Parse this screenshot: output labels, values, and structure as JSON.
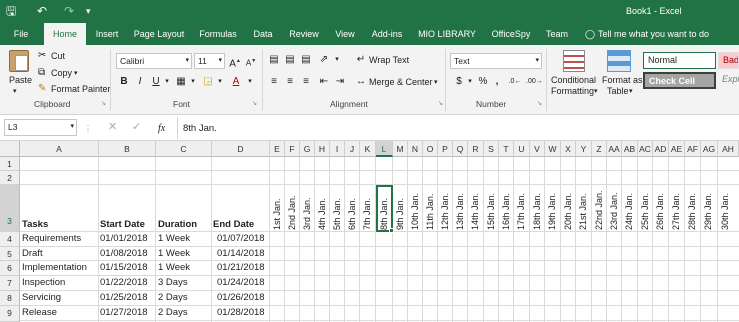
{
  "window": {
    "title": "Book1 - Excel"
  },
  "qat": {
    "save": "save-icon",
    "undo": "undo-icon",
    "redo": "redo-icon"
  },
  "tabs": [
    "File",
    "Home",
    "Insert",
    "Page Layout",
    "Formulas",
    "Data",
    "Review",
    "View",
    "Add-ins",
    "MIO LIBRARY",
    "OfficeSpy",
    "Team"
  ],
  "active_tab": "Home",
  "tell_me": "Tell me what you want to do",
  "ribbon": {
    "clipboard": {
      "paste": "Paste",
      "cut": "Cut",
      "copy": "Copy",
      "format_painter": "Format Painter",
      "group": "Clipboard"
    },
    "font": {
      "name": "Calibri",
      "size": "11",
      "bold": "B",
      "italic": "I",
      "underline": "U",
      "group": "Font"
    },
    "alignment": {
      "wrap": "Wrap Text",
      "merge": "Merge & Center",
      "group": "Alignment"
    },
    "number": {
      "format": "Text",
      "currency": "$",
      "percent": "%",
      "comma": ",",
      "group": "Number"
    },
    "styles": {
      "conditional": "Conditional",
      "formatting": "Formatting",
      "format_as": "Format as",
      "table": "Table",
      "normal": "Normal",
      "bad": "Bad",
      "check_cell": "Check Cell",
      "explanatory": "Expla"
    }
  },
  "formula_bar": {
    "name_box": "L3",
    "fx": "fx",
    "value": "8th Jan."
  },
  "columns": [
    "A",
    "B",
    "C",
    "D",
    "E",
    "F",
    "G",
    "H",
    "I",
    "J",
    "K",
    "L",
    "M",
    "N",
    "O",
    "P",
    "Q",
    "R",
    "S",
    "T",
    "U",
    "V",
    "W",
    "X",
    "Y",
    "Z",
    "AA",
    "AB",
    "AC",
    "AD",
    "AE",
    "AF",
    "AG",
    "AH"
  ],
  "selected_column": "L",
  "rows": [
    "1",
    "2",
    "3",
    "4",
    "5",
    "6",
    "7",
    "8",
    "9"
  ],
  "selected_row": "3",
  "headers": {
    "tasks": "Tasks",
    "start": "Start Date",
    "duration": "Duration",
    "end": "End Date"
  },
  "date_headers": [
    "1st Jan.",
    "2nd Jan.",
    "3rd Jan.",
    "4th Jan.",
    "5th Jan.",
    "6th Jan.",
    "7th Jan.",
    "8th Jan.",
    "9th Jan.",
    "10th Jan.",
    "11th Jan.",
    "12th Jan.",
    "13th Jan.",
    "14th Jan.",
    "15th Jan.",
    "16th Jan.",
    "17th Jan.",
    "18th Jan.",
    "19th Jan.",
    "20th Jan.",
    "21st Jan.",
    "22nd Jan.",
    "23rd Jan.",
    "24th Jan.",
    "25th Jan.",
    "26th Jan.",
    "27th Jan.",
    "28th Jan.",
    "29th Jan.",
    "30th Jan."
  ],
  "tasks": [
    {
      "task": "Requirements",
      "start": "01/01/2018",
      "duration": "1 Week",
      "end": "01/07/2018"
    },
    {
      "task": "Draft",
      "start": "01/08/2018",
      "duration": "1 Week",
      "end": "01/14/2018"
    },
    {
      "task": "Implementation",
      "start": "01/15/2018",
      "duration": "1 Week",
      "end": "01/21/2018"
    },
    {
      "task": "Inspection",
      "start": "01/22/2018",
      "duration": "3 Days",
      "end": "01/24/2018"
    },
    {
      "task": "Servicing",
      "start": "01/25/2018",
      "duration": "2 Days",
      "end": "01/26/2018"
    },
    {
      "task": "Release",
      "start": "01/27/2018",
      "duration": "2 Days",
      "end": "01/28/2018"
    }
  ]
}
